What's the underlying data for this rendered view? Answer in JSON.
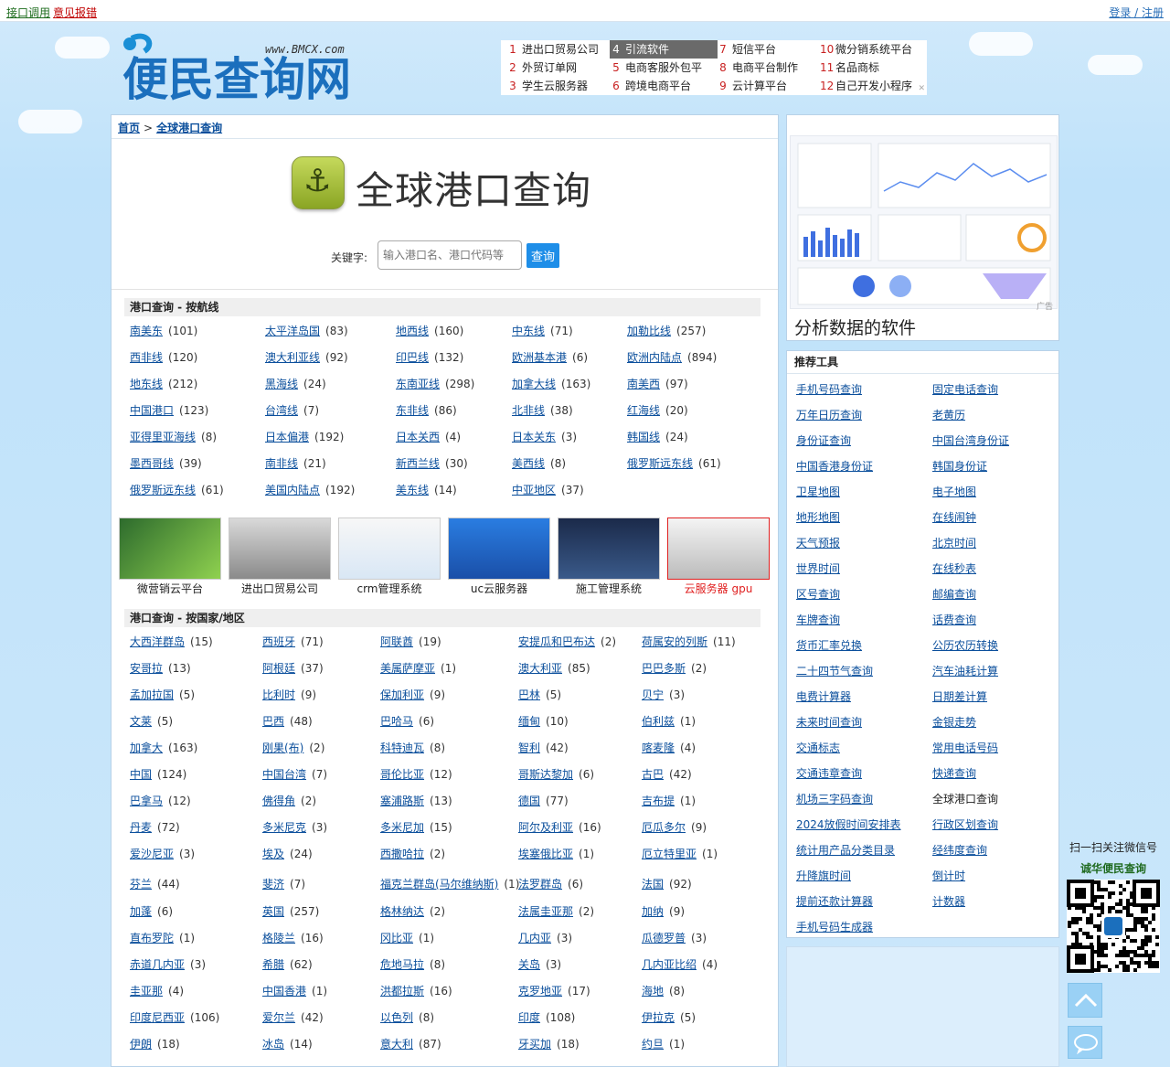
{
  "topbar": {
    "api": "接口调用",
    "feedback": "意见报错",
    "login": "登录 / 注册"
  },
  "logo": {
    "url_text": "www.BMCX.com",
    "name": "便民查询网"
  },
  "adnav": [
    {
      "n": "1",
      "t": "进出口贸易公司"
    },
    {
      "n": "4",
      "t": "引流软件",
      "hl": true
    },
    {
      "n": "7",
      "t": "短信平台"
    },
    {
      "n": "10",
      "t": "微分销系统平台"
    },
    {
      "n": "2",
      "t": "外贸订单网"
    },
    {
      "n": "5",
      "t": "电商客服外包平"
    },
    {
      "n": "8",
      "t": "电商平台制作"
    },
    {
      "n": "11",
      "t": "名品商标"
    },
    {
      "n": "3",
      "t": "学生云服务器"
    },
    {
      "n": "6",
      "t": "跨境电商平台"
    },
    {
      "n": "9",
      "t": "云计算平台"
    },
    {
      "n": "12",
      "t": "自己开发小程序"
    }
  ],
  "breadcrumb": {
    "home": "首页",
    "sep": ">",
    "current": "全球港口查询"
  },
  "page_title": "全球港口查询",
  "search": {
    "label": "关键字:",
    "placeholder": "输入港口名、港口代码等",
    "button": "查询"
  },
  "routes": {
    "title": "港口查询 - 按航线",
    "items": [
      [
        "南美东",
        "(101)"
      ],
      [
        "太平洋岛国",
        "(83)"
      ],
      [
        "地西线",
        "(160)"
      ],
      [
        "中东线",
        "(71)"
      ],
      [
        "加勒比线",
        "(257)"
      ],
      [
        "西非线",
        "(120)"
      ],
      [
        "澳大利亚线",
        "(92)"
      ],
      [
        "印巴线",
        "(132)"
      ],
      [
        "欧洲基本港",
        "(6)"
      ],
      [
        "欧洲内陆点",
        "(894)"
      ],
      [
        "地东线",
        "(212)"
      ],
      [
        "黑海线",
        "(24)"
      ],
      [
        "东南亚线",
        "(298)"
      ],
      [
        "加拿大线",
        "(163)"
      ],
      [
        "南美西",
        "(97)"
      ],
      [
        "中国港口",
        "(123)"
      ],
      [
        "台湾线",
        "(7)"
      ],
      [
        "东非线",
        "(86)"
      ],
      [
        "北非线",
        "(38)"
      ],
      [
        "红海线",
        "(20)"
      ],
      [
        "亚得里亚海线",
        "(8)"
      ],
      [
        "日本偏港",
        "(192)"
      ],
      [
        "日本关西",
        "(4)"
      ],
      [
        "日本关东",
        "(3)"
      ],
      [
        "韩国线",
        "(24)"
      ],
      [
        "墨西哥线",
        "(39)"
      ],
      [
        "南非线",
        "(21)"
      ],
      [
        "新西兰线",
        "(30)"
      ],
      [
        "美西线",
        "(8)"
      ],
      [
        "俄罗斯远东线",
        "(61)"
      ],
      [
        "俄罗斯远东线",
        "(61)"
      ],
      [
        "美国内陆点",
        "(192)"
      ],
      [
        "美东线",
        "(14)"
      ],
      [
        "中亚地区",
        "(37)"
      ]
    ]
  },
  "image_ads": [
    {
      "caption": "微营销云平台"
    },
    {
      "caption": "进出口贸易公司"
    },
    {
      "caption": "crm管理系统"
    },
    {
      "caption": "uc云服务器"
    },
    {
      "caption": "施工管理系统"
    },
    {
      "caption": "云服务器 gpu"
    }
  ],
  "countries": {
    "title": "港口查询 - 按国家/地区",
    "items": [
      [
        "大西洋群岛",
        "(15)"
      ],
      [
        "西班牙",
        "(71)"
      ],
      [
        "阿联酋",
        "(19)"
      ],
      [
        "安提瓜和巴布达",
        "(2)"
      ],
      [
        "荷属安的列斯",
        "(11)"
      ],
      [
        "安哥拉",
        "(13)"
      ],
      [
        "阿根廷",
        "(37)"
      ],
      [
        "美属萨摩亚",
        "(1)"
      ],
      [
        "澳大利亚",
        "(85)"
      ],
      [
        "巴巴多斯",
        "(2)"
      ],
      [
        "孟加拉国",
        "(5)"
      ],
      [
        "比利时",
        "(9)"
      ],
      [
        "保加利亚",
        "(9)"
      ],
      [
        "巴林",
        "(5)"
      ],
      [
        "贝宁",
        "(3)"
      ],
      [
        "文莱",
        "(5)"
      ],
      [
        "巴西",
        "(48)"
      ],
      [
        "巴哈马",
        "(6)"
      ],
      [
        "缅甸",
        "(10)"
      ],
      [
        "伯利兹",
        "(1)"
      ],
      [
        "加拿大",
        "(163)"
      ],
      [
        "刚果(布)",
        "(2)"
      ],
      [
        "科特迪瓦",
        "(8)"
      ],
      [
        "智利",
        "(42)"
      ],
      [
        "喀麦隆",
        "(4)"
      ],
      [
        "中国",
        "(124)"
      ],
      [
        "中国台湾",
        "(7)"
      ],
      [
        "哥伦比亚",
        "(12)"
      ],
      [
        "哥斯达黎加",
        "(6)"
      ],
      [
        "古巴",
        "(42)"
      ],
      [
        "巴拿马",
        "(12)"
      ],
      [
        "佛得角",
        "(2)"
      ],
      [
        "塞浦路斯",
        "(13)"
      ],
      [
        "德国",
        "(77)"
      ],
      [
        "吉布提",
        "(1)"
      ],
      [
        "丹麦",
        "(72)"
      ],
      [
        "多米尼克",
        "(3)"
      ],
      [
        "多米尼加",
        "(15)"
      ],
      [
        "阿尔及利亚",
        "(16)"
      ],
      [
        "厄瓜多尔",
        "(9)"
      ],
      [
        "爱沙尼亚",
        "(3)"
      ],
      [
        "埃及",
        "(24)"
      ],
      [
        "西撒哈拉",
        "(2)"
      ],
      [
        "埃塞俄比亚",
        "(1)"
      ],
      [
        "厄立特里亚",
        "(1)"
      ],
      [
        "芬兰",
        "(44)"
      ],
      [
        "斐济",
        "(7)"
      ],
      [
        "福克兰群岛(马尔维纳斯)",
        "(1)"
      ],
      [
        "法罗群岛",
        "(6)"
      ],
      [
        "法国",
        "(92)"
      ],
      [
        "加蓬",
        "(6)"
      ],
      [
        "英国",
        "(257)"
      ],
      [
        "格林纳达",
        "(2)"
      ],
      [
        "法属圭亚那",
        "(2)"
      ],
      [
        "加纳",
        "(9)"
      ],
      [
        "直布罗陀",
        "(1)"
      ],
      [
        "格陵兰",
        "(16)"
      ],
      [
        "冈比亚",
        "(1)"
      ],
      [
        "几内亚",
        "(3)"
      ],
      [
        "瓜德罗普",
        "(3)"
      ],
      [
        "赤道几内亚",
        "(3)"
      ],
      [
        "希腊",
        "(62)"
      ],
      [
        "危地马拉",
        "(8)"
      ],
      [
        "关岛",
        "(3)"
      ],
      [
        "几内亚比绍",
        "(4)"
      ],
      [
        "圭亚那",
        "(4)"
      ],
      [
        "中国香港",
        "(1)"
      ],
      [
        "洪都拉斯",
        "(16)"
      ],
      [
        "克罗地亚",
        "(17)"
      ],
      [
        "海地",
        "(8)"
      ],
      [
        "印度尼西亚",
        "(106)"
      ],
      [
        "爱尔兰",
        "(42)"
      ],
      [
        "以色列",
        "(8)"
      ],
      [
        "印度",
        "(108)"
      ],
      [
        "伊拉克",
        "(5)"
      ],
      [
        "伊朗",
        "(18)"
      ],
      [
        "冰岛",
        "(14)"
      ],
      [
        "意大利",
        "(87)"
      ],
      [
        "牙买加",
        "(18)"
      ],
      [
        "约旦",
        "(1)"
      ]
    ]
  },
  "side_ad": {
    "caption": "分析数据的软件",
    "tag": "广告"
  },
  "tools": {
    "title": "推荐工具",
    "items": [
      "手机号码查询",
      "固定电话查询",
      "万年日历查询",
      "老黄历",
      "身份证查询",
      "中国台湾身份证",
      "中国香港身份证",
      "韩国身份证",
      "卫星地图",
      "电子地图",
      "地形地图",
      "在线闹钟",
      "天气预报",
      "北京时间",
      "世界时间",
      "在线秒表",
      "区号查询",
      "邮编查询",
      "车牌查询",
      "话费查询",
      "货币汇率兑换",
      "公历农历转换",
      "二十四节气查询",
      "汽车油耗计算",
      "电费计算器",
      "日期差计算",
      "未来时间查询",
      "金银走势",
      "交通标志",
      "常用电话号码",
      "交通违章查询",
      "快递查询",
      "机场三字码查询",
      "全球港口查询",
      "2024放假时间安排表",
      "行政区划查询",
      "统计用产品分类目录",
      "经纬度查询",
      "升降旗时间",
      "倒计时",
      "提前还款计算器",
      "计数器",
      "手机号码生成器"
    ]
  },
  "qr": {
    "line1": "扫一扫关注微信号",
    "line2": "诚华便民查询"
  },
  "colors": {
    "link": "#0b4f9c",
    "accent": "#1e8ee8",
    "sky": "#c4e4fa"
  }
}
